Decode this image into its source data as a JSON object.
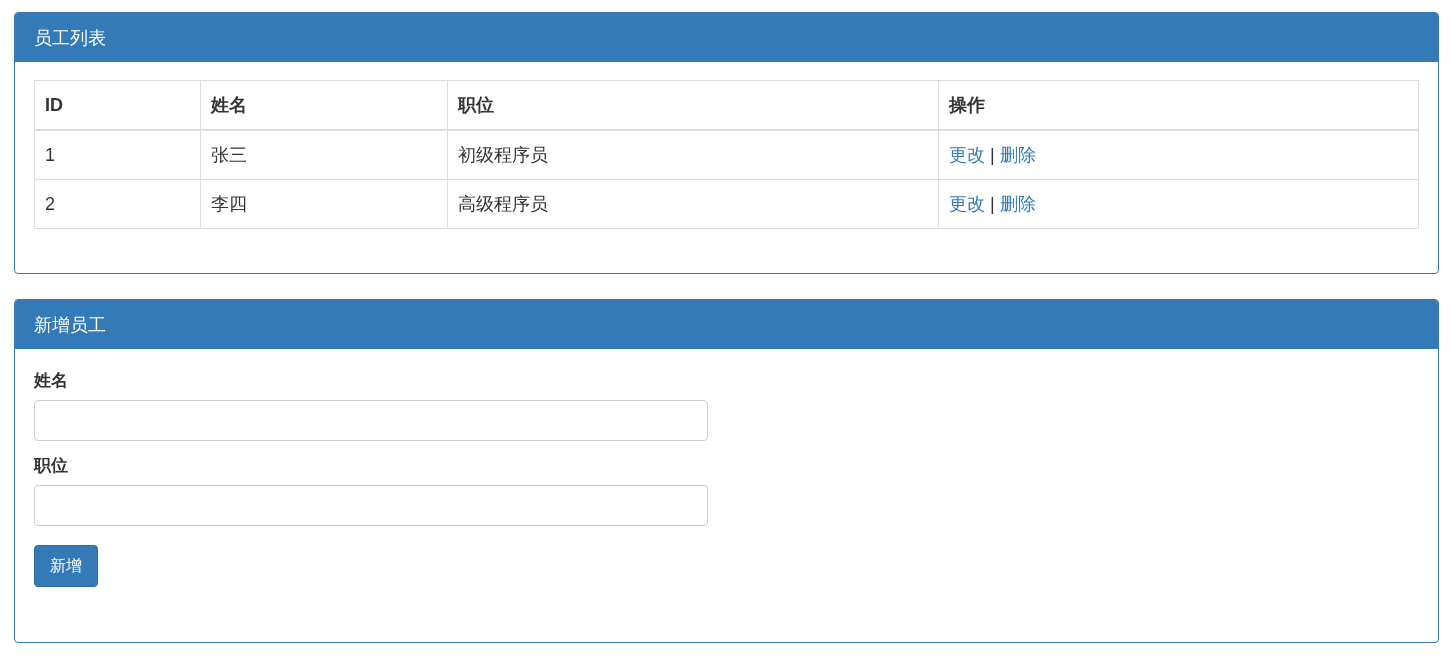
{
  "list_panel": {
    "title": "员工列表",
    "table": {
      "columns": [
        "ID",
        "姓名",
        "职位",
        "操作"
      ],
      "rows": [
        {
          "id": "1",
          "name": "张三",
          "position": "初级程序员",
          "actions": [
            "更改",
            "删除"
          ],
          "separator": "|"
        },
        {
          "id": "2",
          "name": "李四",
          "position": "高级程序员",
          "actions": [
            "更改",
            "删除"
          ],
          "separator": "|"
        }
      ]
    }
  },
  "add_panel": {
    "title": "新增员工",
    "fields": [
      {
        "label": "姓名"
      },
      {
        "label": "职位"
      }
    ],
    "button": "新增"
  }
}
